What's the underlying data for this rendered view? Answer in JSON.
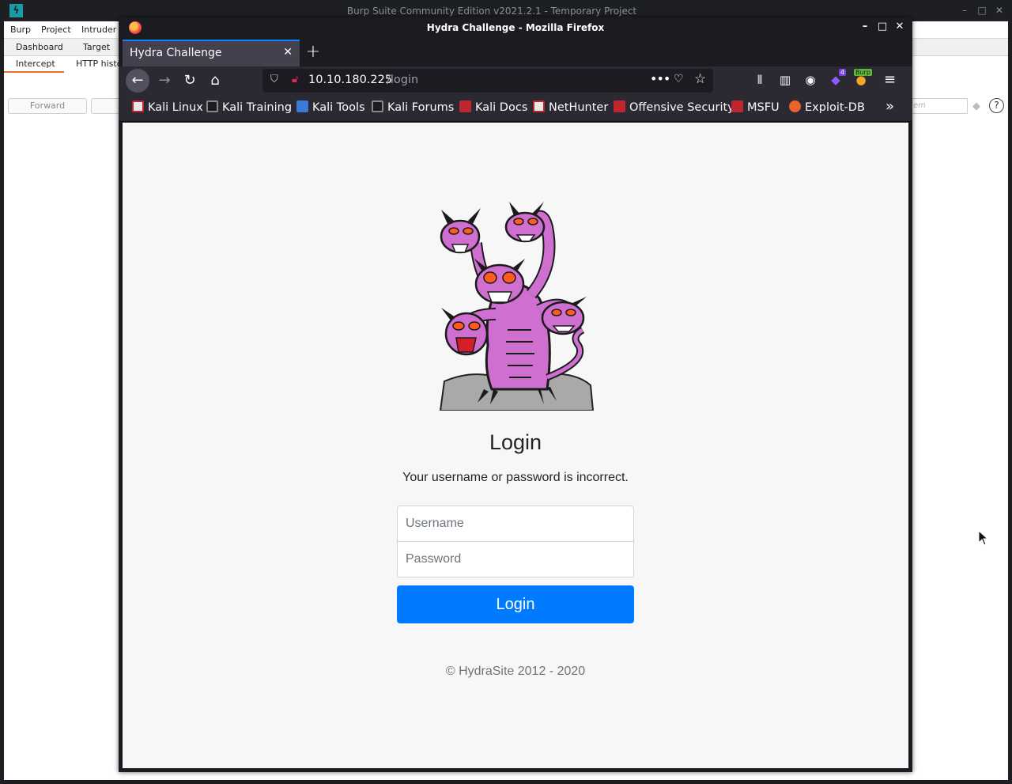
{
  "burp": {
    "title": "Burp Suite Community Edition v2021.2.1 - Temporary Project",
    "menu": [
      "Burp",
      "Project",
      "Intruder"
    ],
    "main_tabs": [
      "Dashboard",
      "Target"
    ],
    "sub_tabs": [
      "Intercept",
      "HTTP histo"
    ],
    "forward_label": "Forward",
    "search_placeholder": "em",
    "help_icon": "?"
  },
  "firefox": {
    "window_title": "Hydra Challenge - Mozilla Firefox",
    "tab_title": "Hydra Challenge",
    "url_host": "10.10.180.225",
    "url_path": "/login",
    "extension_count": "4",
    "burp_badge": "Burp",
    "bookmarks": [
      {
        "label": "Kali Linux",
        "icon_color": "#e8e8e8"
      },
      {
        "label": "Kali Training",
        "icon_color": "#1c1b22"
      },
      {
        "label": "Kali Tools",
        "icon_color": "#3a7bd5"
      },
      {
        "label": "Kali Forums",
        "icon_color": "#1c1b22"
      },
      {
        "label": "Kali Docs",
        "icon_color": "#c0262d"
      },
      {
        "label": "NetHunter",
        "icon_color": "#e8e8e8"
      },
      {
        "label": "Offensive Security",
        "icon_color": "#c0262d"
      },
      {
        "label": "MSFU",
        "icon_color": "#c0262d"
      },
      {
        "label": "Exploit-DB",
        "icon_color": "#e8642c"
      }
    ]
  },
  "page": {
    "heading": "Login",
    "message": "Your username or password is incorrect.",
    "username_placeholder": "Username",
    "password_placeholder": "Password",
    "login_button": "Login",
    "footer": "© HydraSite 2012 - 2020"
  },
  "colors": {
    "primary_button": "#007bff",
    "firefox_accent": "#0a84ff",
    "burp_accent": "#e8722f"
  }
}
